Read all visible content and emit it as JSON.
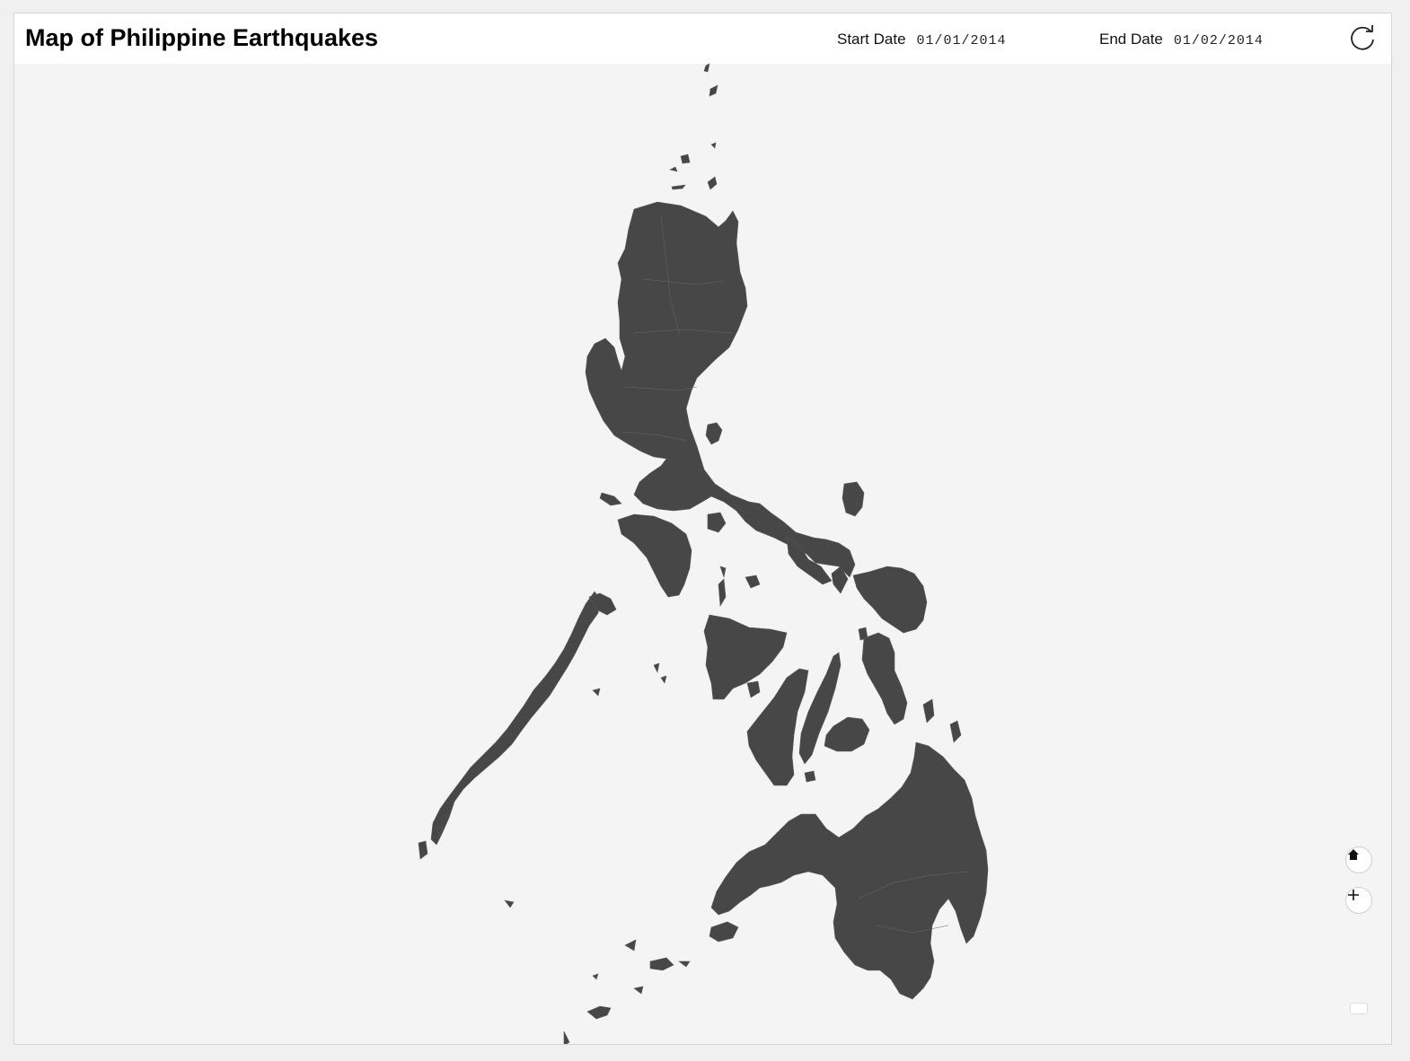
{
  "header": {
    "title": "Map of Philippine Earthquakes",
    "start_date_label": "Start Date",
    "start_date_value": "01/01/2014",
    "end_date_label": "End Date",
    "end_date_value": "01/02/2014"
  },
  "icons": {
    "refresh": "refresh-icon",
    "home": "home-icon",
    "zoom_in": "plus-icon",
    "zoom_out": "minus-icon"
  },
  "colors": {
    "land": "#474747",
    "background": "#f4f4f4",
    "header": "#ffffff"
  },
  "map": {
    "country": "Philippines",
    "earthquake_markers": []
  }
}
